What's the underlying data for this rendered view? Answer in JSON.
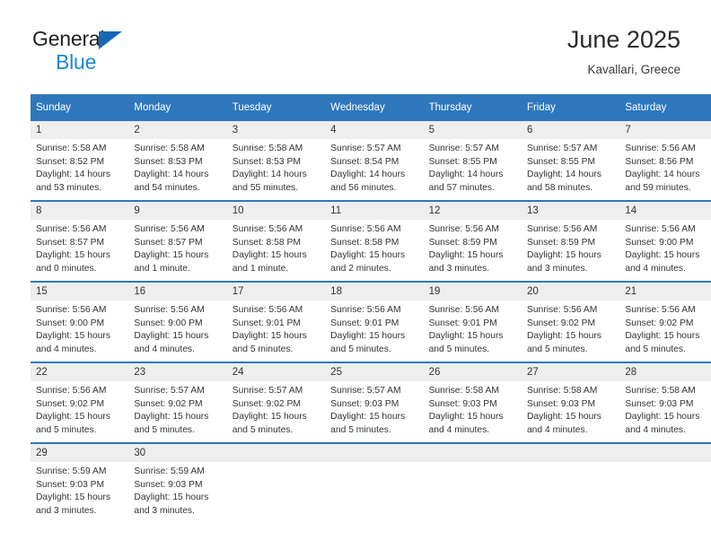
{
  "brand": {
    "name_part1": "General",
    "name_part2": "Blue",
    "triangle_color": "#1668b3",
    "blue_color": "#1f86d0"
  },
  "header": {
    "title": "June 2025",
    "subtitle": "Kavallari, Greece"
  },
  "theme": {
    "header_blue": "#2f77bc",
    "daynum_gray": "#eeeeee",
    "text": "#333333"
  },
  "weekdays": [
    "Sunday",
    "Monday",
    "Tuesday",
    "Wednesday",
    "Thursday",
    "Friday",
    "Saturday"
  ],
  "weeks": [
    [
      {
        "day": "1",
        "sunrise": "Sunrise: 5:58 AM",
        "sunset": "Sunset: 8:52 PM",
        "daylight_line1": "Daylight: 14 hours",
        "daylight_line2": "and 53 minutes."
      },
      {
        "day": "2",
        "sunrise": "Sunrise: 5:58 AM",
        "sunset": "Sunset: 8:53 PM",
        "daylight_line1": "Daylight: 14 hours",
        "daylight_line2": "and 54 minutes."
      },
      {
        "day": "3",
        "sunrise": "Sunrise: 5:58 AM",
        "sunset": "Sunset: 8:53 PM",
        "daylight_line1": "Daylight: 14 hours",
        "daylight_line2": "and 55 minutes."
      },
      {
        "day": "4",
        "sunrise": "Sunrise: 5:57 AM",
        "sunset": "Sunset: 8:54 PM",
        "daylight_line1": "Daylight: 14 hours",
        "daylight_line2": "and 56 minutes."
      },
      {
        "day": "5",
        "sunrise": "Sunrise: 5:57 AM",
        "sunset": "Sunset: 8:55 PM",
        "daylight_line1": "Daylight: 14 hours",
        "daylight_line2": "and 57 minutes."
      },
      {
        "day": "6",
        "sunrise": "Sunrise: 5:57 AM",
        "sunset": "Sunset: 8:55 PM",
        "daylight_line1": "Daylight: 14 hours",
        "daylight_line2": "and 58 minutes."
      },
      {
        "day": "7",
        "sunrise": "Sunrise: 5:56 AM",
        "sunset": "Sunset: 8:56 PM",
        "daylight_line1": "Daylight: 14 hours",
        "daylight_line2": "and 59 minutes."
      }
    ],
    [
      {
        "day": "8",
        "sunrise": "Sunrise: 5:56 AM",
        "sunset": "Sunset: 8:57 PM",
        "daylight_line1": "Daylight: 15 hours",
        "daylight_line2": "and 0 minutes."
      },
      {
        "day": "9",
        "sunrise": "Sunrise: 5:56 AM",
        "sunset": "Sunset: 8:57 PM",
        "daylight_line1": "Daylight: 15 hours",
        "daylight_line2": "and 1 minute."
      },
      {
        "day": "10",
        "sunrise": "Sunrise: 5:56 AM",
        "sunset": "Sunset: 8:58 PM",
        "daylight_line1": "Daylight: 15 hours",
        "daylight_line2": "and 1 minute."
      },
      {
        "day": "11",
        "sunrise": "Sunrise: 5:56 AM",
        "sunset": "Sunset: 8:58 PM",
        "daylight_line1": "Daylight: 15 hours",
        "daylight_line2": "and 2 minutes."
      },
      {
        "day": "12",
        "sunrise": "Sunrise: 5:56 AM",
        "sunset": "Sunset: 8:59 PM",
        "daylight_line1": "Daylight: 15 hours",
        "daylight_line2": "and 3 minutes."
      },
      {
        "day": "13",
        "sunrise": "Sunrise: 5:56 AM",
        "sunset": "Sunset: 8:59 PM",
        "daylight_line1": "Daylight: 15 hours",
        "daylight_line2": "and 3 minutes."
      },
      {
        "day": "14",
        "sunrise": "Sunrise: 5:56 AM",
        "sunset": "Sunset: 9:00 PM",
        "daylight_line1": "Daylight: 15 hours",
        "daylight_line2": "and 4 minutes."
      }
    ],
    [
      {
        "day": "15",
        "sunrise": "Sunrise: 5:56 AM",
        "sunset": "Sunset: 9:00 PM",
        "daylight_line1": "Daylight: 15 hours",
        "daylight_line2": "and 4 minutes."
      },
      {
        "day": "16",
        "sunrise": "Sunrise: 5:56 AM",
        "sunset": "Sunset: 9:00 PM",
        "daylight_line1": "Daylight: 15 hours",
        "daylight_line2": "and 4 minutes."
      },
      {
        "day": "17",
        "sunrise": "Sunrise: 5:56 AM",
        "sunset": "Sunset: 9:01 PM",
        "daylight_line1": "Daylight: 15 hours",
        "daylight_line2": "and 5 minutes."
      },
      {
        "day": "18",
        "sunrise": "Sunrise: 5:56 AM",
        "sunset": "Sunset: 9:01 PM",
        "daylight_line1": "Daylight: 15 hours",
        "daylight_line2": "and 5 minutes."
      },
      {
        "day": "19",
        "sunrise": "Sunrise: 5:56 AM",
        "sunset": "Sunset: 9:01 PM",
        "daylight_line1": "Daylight: 15 hours",
        "daylight_line2": "and 5 minutes."
      },
      {
        "day": "20",
        "sunrise": "Sunrise: 5:56 AM",
        "sunset": "Sunset: 9:02 PM",
        "daylight_line1": "Daylight: 15 hours",
        "daylight_line2": "and 5 minutes."
      },
      {
        "day": "21",
        "sunrise": "Sunrise: 5:56 AM",
        "sunset": "Sunset: 9:02 PM",
        "daylight_line1": "Daylight: 15 hours",
        "daylight_line2": "and 5 minutes."
      }
    ],
    [
      {
        "day": "22",
        "sunrise": "Sunrise: 5:56 AM",
        "sunset": "Sunset: 9:02 PM",
        "daylight_line1": "Daylight: 15 hours",
        "daylight_line2": "and 5 minutes."
      },
      {
        "day": "23",
        "sunrise": "Sunrise: 5:57 AM",
        "sunset": "Sunset: 9:02 PM",
        "daylight_line1": "Daylight: 15 hours",
        "daylight_line2": "and 5 minutes."
      },
      {
        "day": "24",
        "sunrise": "Sunrise: 5:57 AM",
        "sunset": "Sunset: 9:02 PM",
        "daylight_line1": "Daylight: 15 hours",
        "daylight_line2": "and 5 minutes."
      },
      {
        "day": "25",
        "sunrise": "Sunrise: 5:57 AM",
        "sunset": "Sunset: 9:03 PM",
        "daylight_line1": "Daylight: 15 hours",
        "daylight_line2": "and 5 minutes."
      },
      {
        "day": "26",
        "sunrise": "Sunrise: 5:58 AM",
        "sunset": "Sunset: 9:03 PM",
        "daylight_line1": "Daylight: 15 hours",
        "daylight_line2": "and 4 minutes."
      },
      {
        "day": "27",
        "sunrise": "Sunrise: 5:58 AM",
        "sunset": "Sunset: 9:03 PM",
        "daylight_line1": "Daylight: 15 hours",
        "daylight_line2": "and 4 minutes."
      },
      {
        "day": "28",
        "sunrise": "Sunrise: 5:58 AM",
        "sunset": "Sunset: 9:03 PM",
        "daylight_line1": "Daylight: 15 hours",
        "daylight_line2": "and 4 minutes."
      }
    ],
    [
      {
        "day": "29",
        "sunrise": "Sunrise: 5:59 AM",
        "sunset": "Sunset: 9:03 PM",
        "daylight_line1": "Daylight: 15 hours",
        "daylight_line2": "and 3 minutes."
      },
      {
        "day": "30",
        "sunrise": "Sunrise: 5:59 AM",
        "sunset": "Sunset: 9:03 PM",
        "daylight_line1": "Daylight: 15 hours",
        "daylight_line2": "and 3 minutes."
      },
      {
        "day": "",
        "sunrise": "",
        "sunset": "",
        "daylight_line1": "",
        "daylight_line2": ""
      },
      {
        "day": "",
        "sunrise": "",
        "sunset": "",
        "daylight_line1": "",
        "daylight_line2": ""
      },
      {
        "day": "",
        "sunrise": "",
        "sunset": "",
        "daylight_line1": "",
        "daylight_line2": ""
      },
      {
        "day": "",
        "sunrise": "",
        "sunset": "",
        "daylight_line1": "",
        "daylight_line2": ""
      },
      {
        "day": "",
        "sunrise": "",
        "sunset": "",
        "daylight_line1": "",
        "daylight_line2": ""
      }
    ]
  ]
}
